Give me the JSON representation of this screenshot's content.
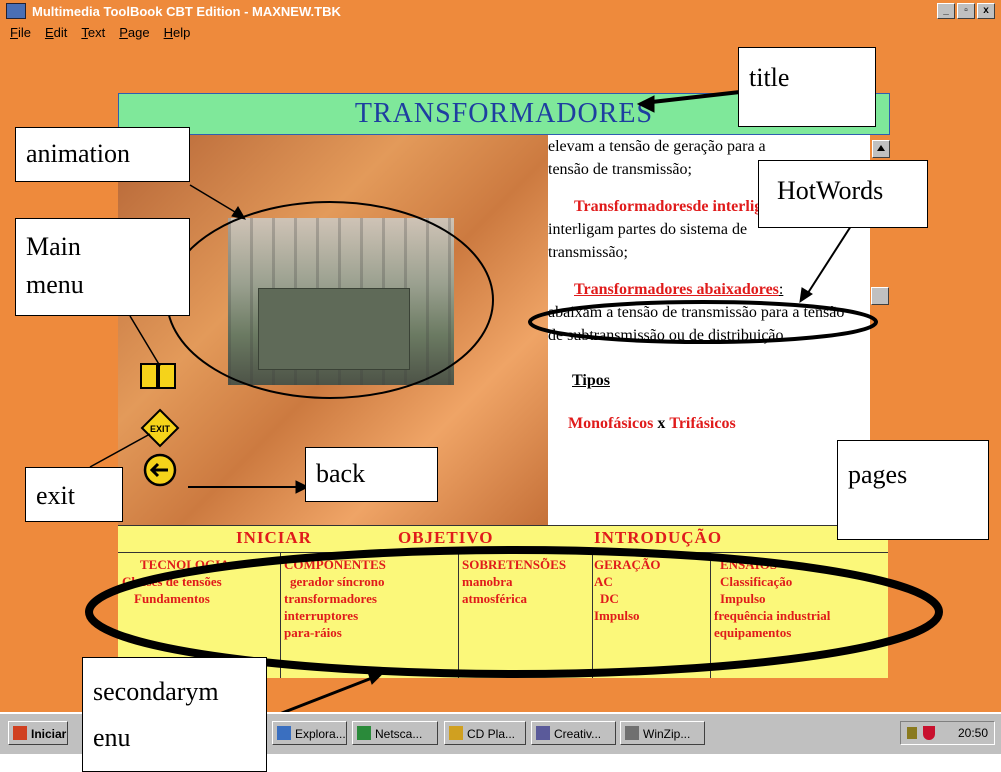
{
  "window": {
    "title": "Multimedia ToolBook CBT Edition - MAXNEW.TBK",
    "controls": [
      "_",
      "▫",
      "x"
    ]
  },
  "menu": [
    "File",
    "Edit",
    "Text",
    "Page",
    "Help"
  ],
  "page": {
    "title": "TRANSFORMADORES",
    "text": {
      "line1": "elevam a tensão de geração para a",
      "line2": "tensão de transmissão;",
      "interlig_term": "Transformadoresde interligação",
      "interlig_colon": ":",
      "interlig_body": "interligam partes do sistema de transmissão;",
      "abaix_term": "Transformadores abaixadores",
      "abaix_colon": ":",
      "abaix_body": "abaixam a tensão de transmissão para a tensão de subtransmissão ou de distribuição.",
      "tipos": "Tipos",
      "mono": "Monofásicos",
      "x": "x",
      "tri": "Trifásicos"
    }
  },
  "secondary_menu": {
    "top": [
      "INICIAR",
      "OBJETIVO",
      "INTRODUÇÃO"
    ],
    "columns": [
      {
        "header": "TECNOLOGIA",
        "items": [
          "Classes de tensões",
          "Fundamentos"
        ]
      },
      {
        "header": "COMPONENTES",
        "items": [
          "gerador síncrono",
          "transformadores",
          "interruptores",
          "para-ráios"
        ]
      },
      {
        "header": "SOBRETENSÕES",
        "items": [
          "manobra",
          "atmosférica"
        ]
      },
      {
        "header": "GERAÇÃO",
        "items": [
          "AC",
          "DC",
          "Impulso"
        ]
      },
      {
        "header": "ENSAIOS",
        "items": [
          "Classificação",
          "Impulso",
          "frequência industrial",
          "equipamentos"
        ]
      }
    ]
  },
  "annotations": {
    "title": "title",
    "animation": "animation",
    "main_menu_1": "Main",
    "main_menu_2": "menu",
    "hotwords": "HotWords",
    "exit": "exit",
    "back": "back",
    "pages": "pages",
    "secondary_1": "secondarym",
    "secondary_2": "enu"
  },
  "taskbar": {
    "start": "Iniciar",
    "buttons": [
      "Explora...",
      "Netsca...",
      "CD Pla...",
      "Creativ...",
      "WinZip..."
    ],
    "clock": "20:50"
  },
  "colors": {
    "title_bar": "#ee8a3c",
    "page_title_bg": "#7fe89a",
    "page_title_text": "#1e3ea0",
    "hotword": "#e01b1b",
    "secondary_bg": "#fbf87a"
  }
}
